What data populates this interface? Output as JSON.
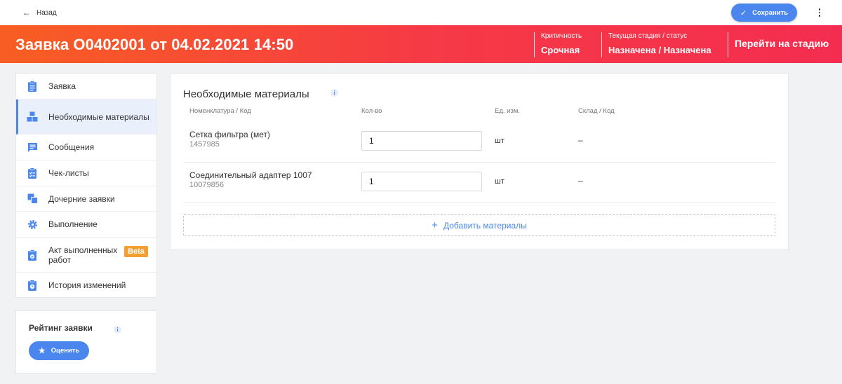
{
  "topbar": {
    "back_label": "Назад",
    "save_label": "Сохранить"
  },
  "banner": {
    "title": "Заявка O0402001 от 04.02.2021 14:50",
    "criticality_label": "Критичность",
    "criticality_value": "Срочная",
    "stage_label": "Текущая стадия / статус",
    "stage_value": "Назначена / Назначена",
    "goto_label": "Перейти на стадию"
  },
  "sidebar": {
    "items": [
      {
        "label": "Заявка",
        "icon": "clipboard-icon"
      },
      {
        "label": "Необходимые материалы",
        "icon": "boxes-icon",
        "active": true
      },
      {
        "label": "Сообщения",
        "icon": "message-icon"
      },
      {
        "label": "Чек-листы",
        "icon": "checklist-icon"
      },
      {
        "label": "Дочерние заявки",
        "icon": "child-requests-icon"
      },
      {
        "label": "Выполнение",
        "icon": "gear-icon"
      },
      {
        "label": "Акт выполненных работ",
        "icon": "act-icon",
        "badge": "Beta"
      },
      {
        "label": "История изменений",
        "icon": "history-icon"
      }
    ]
  },
  "rating": {
    "title": "Рейтинг заявки",
    "info": "i",
    "button_label": "Оценить"
  },
  "materials": {
    "title": "Необходимые материалы",
    "info": "i",
    "columns": [
      "Номенклатура / Код",
      "Кол-во",
      "Ед. изм.",
      "Склад / Код"
    ],
    "rows": [
      {
        "name": "Сетка фильтра (мет)",
        "code": "1457985",
        "qty": "1",
        "unit": "шт",
        "stock": "–"
      },
      {
        "name": "Соединительный адаптер 1007",
        "code": "10079856",
        "qty": "1",
        "unit": "шт",
        "stock": "–"
      }
    ],
    "add_label": "Добавить материалы"
  },
  "colors": {
    "accent": "#4a86ee",
    "banner_start": "#f85e23",
    "banner_end": "#f42d50",
    "beta": "#f59e32"
  }
}
